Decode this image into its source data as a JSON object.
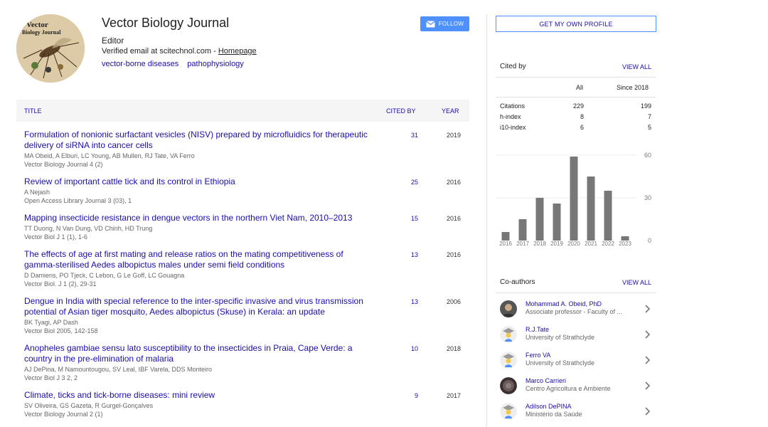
{
  "profile": {
    "name": "Vector Biology Journal",
    "role": "Editor",
    "email_text": "Verified email at scitechnol.com - ",
    "homepage_label": "Homepage",
    "interests": [
      "vector-borne diseases",
      "pathophysiology"
    ],
    "avatar_text_1": "Vector",
    "avatar_text_2": "Biology Journal",
    "follow_label": "FOLLOW"
  },
  "table": {
    "headers": {
      "title": "TITLE",
      "cited_by": "CITED BY",
      "year": "YEAR"
    },
    "rows": [
      {
        "title": "Formulation of nonionic surfactant vesicles (NISV) prepared by microfluidics for therapeutic delivery of siRNA into cancer cells",
        "authors": "MA Obeid, A Elburi, LC Young, AB Mullen, RJ Tate, VA Ferro",
        "venue": "Vector Biology Journal 4 (2)",
        "cited": "31",
        "year": "2019"
      },
      {
        "title": "Review of important cattle tick and its control in Ethiopia",
        "authors": "A Nejash",
        "venue": "Open Access Library Journal 3 (03), 1",
        "cited": "25",
        "year": "2016"
      },
      {
        "title": "Mapping insecticide resistance in dengue vectors in the northern Viet Nam, 2010–2013",
        "authors": "TT Duong, N Van Dung, VD Chinh, HD Trung",
        "venue": "Vector Biol J 1 (1), 1-6",
        "cited": "15",
        "year": "2016"
      },
      {
        "title": "The effects of age at first mating and release ratios on the mating competitiveness of gamma-sterilised Aedes albopictus males under semi field conditions",
        "authors": "D Damiens, PO Tjeck, C Lebon, G Le Goff, LC Gouagna",
        "venue": "Vector Biol. J 1 (2), 29-31",
        "cited": "13",
        "year": "2016"
      },
      {
        "title": "Dengue in India with special reference to the inter-specific invasive and virus transmission potential of Asian tiger mosquito, Aedes albopictus (Skuse) in Kerala: an update",
        "authors": "BK Tyagi, AP Dash",
        "venue": "Vector Biol 2005, 142-158",
        "cited": "13",
        "year": "2006"
      },
      {
        "title": "Anopheles gambiae sensu lato susceptibility to the insecticides in Praia, Cape Verde: a country in the pre-elimination of malaria",
        "authors": "AJ DePina, M Namountougou, SV Leal, IBF Varela, DDS Monteiro",
        "venue": "Vector Biol J 3 2, 2",
        "cited": "10",
        "year": "2018"
      },
      {
        "title": "Climate, ticks and tick-borne diseases: mini review",
        "authors": "SV Oliveira, GS Gazeta, R Gurgel-Gonçalves",
        "venue": "Vector Biology Journal 2 (1)",
        "cited": "9",
        "year": "2017"
      }
    ]
  },
  "sidebar": {
    "get_profile_label": "GET MY OWN PROFILE",
    "cited_by": {
      "title": "Cited by",
      "view_all": "VIEW ALL",
      "col_all": "All",
      "col_since": "Since 2018",
      "stats": [
        {
          "label": "Citations",
          "all": "229",
          "since": "199"
        },
        {
          "label": "h-index",
          "all": "8",
          "since": "7"
        },
        {
          "label": "i10-index",
          "all": "6",
          "since": "5"
        }
      ]
    },
    "coauthors": {
      "title": "Co-authors",
      "view_all": "VIEW ALL",
      "items": [
        {
          "name": "Mohammad A. Obeid, PhD",
          "affiliation": "Associate professor - Faculty of ...",
          "photo": "person-photo"
        },
        {
          "name": "R.J.Tate",
          "affiliation": "University of Strathclyde",
          "photo": "default-avatar-icon"
        },
        {
          "name": "Ferro VA",
          "affiliation": "University of Strathclyde",
          "photo": "default-avatar-icon"
        },
        {
          "name": "Marco Carrieri",
          "affiliation": "Centro Agricoltura e Ambiente",
          "photo": "person-photo"
        },
        {
          "name": "Adilson DePINA",
          "affiliation": "Ministério da Saúde",
          "photo": "default-avatar-icon"
        }
      ]
    }
  },
  "chart_data": {
    "type": "bar",
    "categories": [
      "2016",
      "2017",
      "2018",
      "2019",
      "2020",
      "2021",
      "2022",
      "2023"
    ],
    "values": [
      6,
      15,
      30,
      26,
      59,
      45,
      35,
      3
    ],
    "ylim": [
      0,
      60
    ],
    "yticks": [
      0,
      30,
      60
    ],
    "grid": true,
    "colors": {
      "bar": "#777777",
      "grid": "#eeeeee"
    }
  },
  "colors": {
    "link": "#1a0dab",
    "accent": "#4d90fe",
    "header_bg": "#f5f5f5"
  }
}
